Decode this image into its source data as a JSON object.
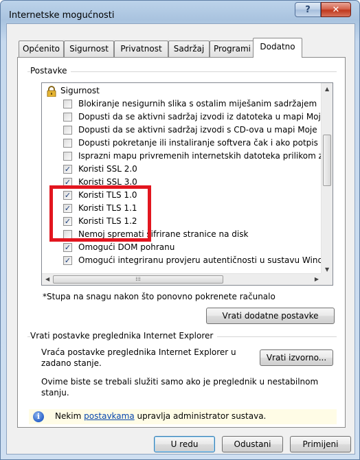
{
  "window": {
    "title": "Internetske mogućnosti",
    "help_glyph": "?",
    "close_glyph": "✕"
  },
  "tabs": [
    "Općenito",
    "Sigurnost",
    "Privatnost",
    "Sadržaj",
    "Programi",
    "Dodatno"
  ],
  "active_tab": "Dodatno",
  "settings": {
    "group_label": "Postavke",
    "category": "Sigurnost",
    "items": [
      {
        "label": "Blokiranje nesigurnih slika s ostalim miješanim sadržajem",
        "checked": false
      },
      {
        "label": "Dopusti da se aktivni sadržaj izvodi iz datoteka u mapi Moj",
        "checked": false
      },
      {
        "label": "Dopusti da se aktivni sadržaj izvodi s CD-ova u mapi Moje",
        "checked": false
      },
      {
        "label": "Dopusti pokretanje ili instaliranje softvera čak i ako potpis",
        "checked": false
      },
      {
        "label": "Isprazni mapu privremenih internetskih datoteka prilikom z",
        "checked": false
      },
      {
        "label": "Koristi SSL 2.0",
        "checked": true
      },
      {
        "label": "Koristi SSL 3.0",
        "checked": true
      },
      {
        "label": "Koristi TLS 1.0",
        "checked": true
      },
      {
        "label": "Koristi TLS 1.1",
        "checked": true
      },
      {
        "label": "Koristi TLS 1.2",
        "checked": true
      },
      {
        "label": "Nemoj spremati šifrirane stranice na disk",
        "checked": false
      },
      {
        "label": "Omogući DOM pohranu",
        "checked": true
      },
      {
        "label": "Omogući integriranu provjeru autentičnosti u sustavu Wind",
        "checked": true
      }
    ],
    "restart_note": "*Stupa na snagu nakon što ponovno pokrenete računalo",
    "restore_advanced_button": "Vrati dodatne postavke"
  },
  "reset": {
    "group_label": "Vrati postavke preglednika Internet Explorer",
    "description": "Vraća postavke preglednika Internet Explorer u zadano stanje.",
    "reset_button": "Vrati izvorno...",
    "warning": "Ovime biste se trebali služiti samo ako je preglednik u nestabilnom stanju."
  },
  "info_bar": {
    "prefix": "Nekim",
    "link": "postavkama",
    "suffix": "upravlja administrator sustava."
  },
  "footer": {
    "ok": "U redu",
    "cancel": "Odustani",
    "apply": "Primijeni"
  },
  "icons": {
    "category": "lock-icon",
    "info": "info-icon"
  },
  "colors": {
    "highlight_box": "#e2161f",
    "close_button": "#c0391e",
    "info_bar_bg": "#fffce6",
    "link": "#0645ad"
  }
}
